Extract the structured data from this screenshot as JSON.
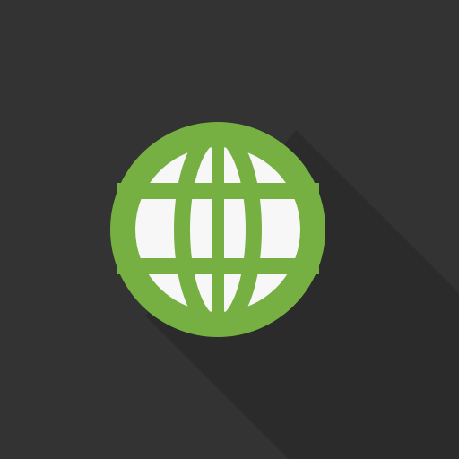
{
  "icon": {
    "name": "globe-icon",
    "colors": {
      "background": "#333333",
      "long_shadow": "#2b2b2b",
      "globe_green": "#76b043",
      "globe_fill": "#f7f7f7"
    }
  }
}
